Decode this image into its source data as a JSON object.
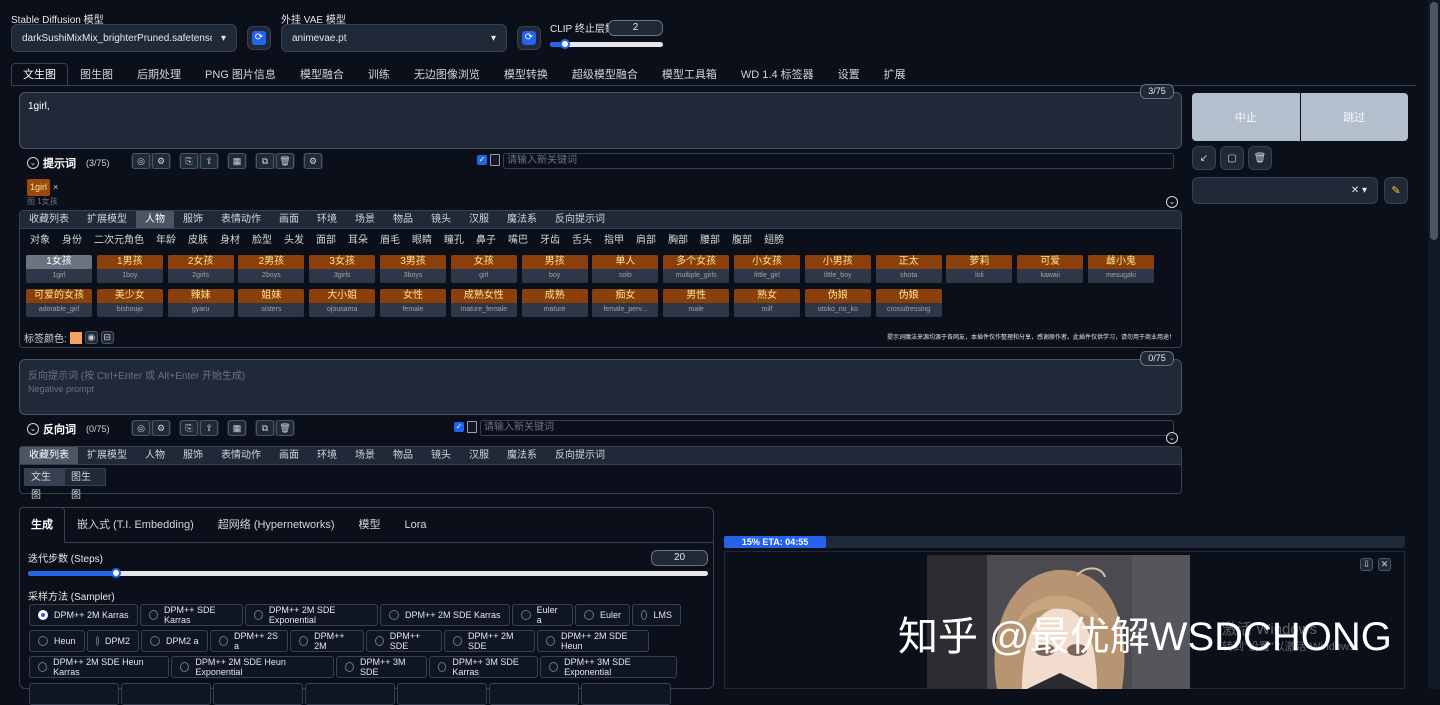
{
  "top": {
    "sd_model_label": "Stable Diffusion 模型",
    "sd_model_value": "darkSushiMixMix_brighterPruned.safetensors [€",
    "vae_label": "外挂 VAE 模型",
    "vae_value": "animevae.pt",
    "clip_label": "CLIP 终止层数",
    "clip_value": "2"
  },
  "main_tabs": [
    "文生图",
    "图生图",
    "后期处理",
    "PNG 图片信息",
    "模型融合",
    "训练",
    "无边图像浏览",
    "模型转换",
    "超级模型融合",
    "模型工具箱",
    "WD 1.4 标签器",
    "设置",
    "扩展"
  ],
  "prompt": {
    "text": "1girl,",
    "counter": "3/75",
    "section_label": "提示词",
    "section_count": "(3/75)",
    "keyword_placeholder": "请输入新关键词",
    "chip_label": "1girl",
    "chip_translation": "图 1女孩",
    "color_label": "标签颜色:",
    "notice": "提示词魔法来源均源于各网友，本插件仅作整理和分享，感谢原作者。此插件仅供学习，请勿用于商业用途！"
  },
  "buttons": {
    "interrupt": "中止",
    "skip": "跳过"
  },
  "categories": [
    "收藏列表",
    "扩展模型",
    "人物",
    "服饰",
    "表情动作",
    "画面",
    "环境",
    "场景",
    "物品",
    "镜头",
    "汉服",
    "魔法系",
    "反向提示词"
  ],
  "subcategories": [
    "对象",
    "身份",
    "二次元角色",
    "年龄",
    "皮肤",
    "身材",
    "脸型",
    "头发",
    "面部",
    "耳朵",
    "眉毛",
    "眼睛",
    "瞳孔",
    "鼻子",
    "嘴巴",
    "牙齿",
    "舌头",
    "指甲",
    "肩部",
    "胸部",
    "腰部",
    "腹部",
    "翅膀"
  ],
  "tag_rows": [
    [
      [
        "1女孩",
        "1girl"
      ],
      [
        "1男孩",
        "1boy"
      ],
      [
        "2女孩",
        "2girls"
      ],
      [
        "2男孩",
        "2boys"
      ],
      [
        "3女孩",
        "3girls"
      ],
      [
        "3男孩",
        "3boys"
      ],
      [
        "女孩",
        "girl"
      ],
      [
        "男孩",
        "boy"
      ],
      [
        "单人",
        "solo"
      ],
      [
        "多个女孩",
        "multiple_girls"
      ],
      [
        "小女孩",
        "little_girl"
      ],
      [
        "小男孩",
        "little_boy"
      ],
      [
        "正太",
        "shota"
      ],
      [
        "萝莉",
        "loli"
      ],
      [
        "可爱",
        "kawaii"
      ],
      [
        "雌小鬼",
        "mesugaki"
      ]
    ],
    [
      [
        "可爱的女孩",
        "adorable_girl"
      ],
      [
        "美少女",
        "bishoujo"
      ],
      [
        "辣妹",
        "gyaru"
      ],
      [
        "姐妹",
        "sisters"
      ],
      [
        "大小姐",
        "ojousama"
      ],
      [
        "女性",
        "female"
      ],
      [
        "成熟女性",
        "mature_female"
      ],
      [
        "成熟",
        "mature"
      ],
      [
        "痴女",
        "female_perv..."
      ],
      [
        "男性",
        "male"
      ],
      [
        "熟女",
        "milf"
      ],
      [
        "伪娘",
        "otoko_no_ko"
      ],
      [
        "伪娘",
        "crossdressing"
      ]
    ]
  ],
  "negative": {
    "placeholder": "反向提示词 (按 Ctrl+Enter 或 Alt+Enter 开始生成)",
    "sub_placeholder": "Negative prompt",
    "counter": "0/75",
    "section_label": "反向词",
    "section_count": "(0/75)",
    "keyword_placeholder": "请输入新关键词",
    "subtabs": [
      "文生图",
      "图生图"
    ]
  },
  "gen_tabs": [
    "生成",
    "嵌入式 (T.I. Embedding)",
    "超网络 (Hypernetworks)",
    "模型",
    "Lora"
  ],
  "steps": {
    "label": "迭代步数 (Steps)",
    "value": "20",
    "fraction": 0.13
  },
  "sampler": {
    "label": "采样方法 (Sampler)",
    "row1": [
      "DPM++ 2M Karras",
      "DPM++ SDE Karras",
      "DPM++ 2M SDE Exponential",
      "DPM++ 2M SDE Karras",
      "Euler a",
      "Euler",
      "LMS"
    ],
    "row2": [
      "Heun",
      "DPM2",
      "DPM2 a",
      "DPM++ 2S a",
      "DPM++ 2M",
      "DPM++ SDE",
      "DPM++ 2M SDE",
      "DPM++ 2M SDE Heun"
    ],
    "row3": [
      "DPM++ 2M SDE Heun Karras",
      "DPM++ 2M SDE Heun Exponential",
      "DPM++ 3M SDE",
      "DPM++ 3M SDE Karras",
      "DPM++ 3M SDE Exponential"
    ]
  },
  "progress": {
    "text": "15% ETA: 04:55",
    "fraction": 0.15
  },
  "watermark": {
    "text": "知乎 @最优解WSDCHONG",
    "activate1": "激活 Windows",
    "activate2": "转到\"设置\"以激活 Windows。"
  },
  "colors": {
    "accent": "#2563eb",
    "tag_orange": "#8b3f0a",
    "background": "#0b0f19"
  }
}
